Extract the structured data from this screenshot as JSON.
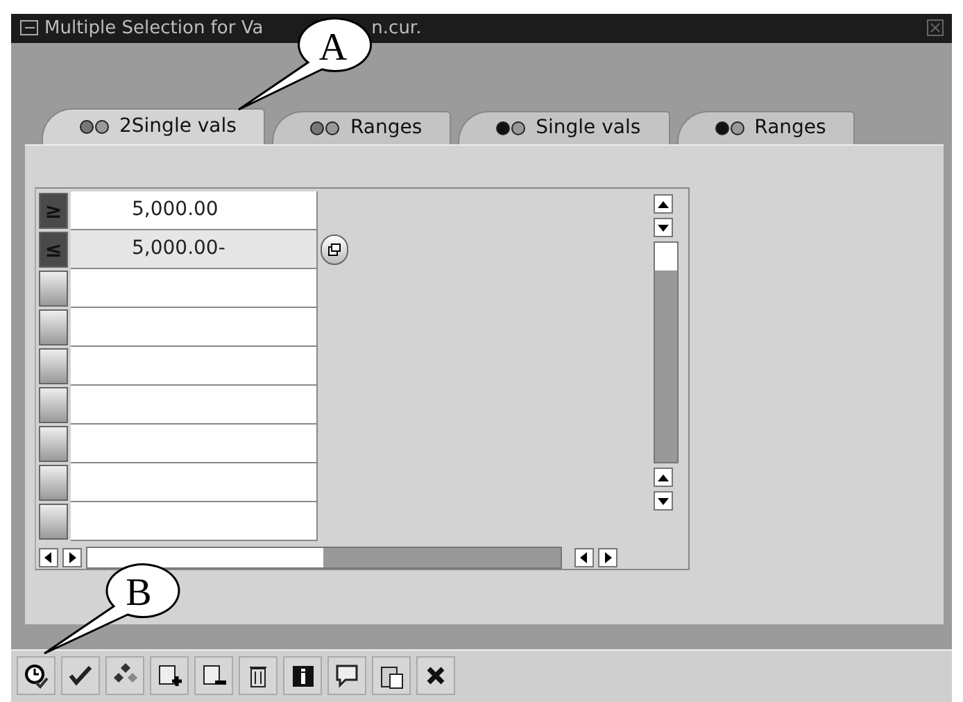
{
  "window": {
    "title_parts": [
      "Multiple Selection for Va",
      "n.cur."
    ]
  },
  "tabs": [
    {
      "label": "2Single vals",
      "selected": true,
      "kind": "include"
    },
    {
      "label": "Ranges",
      "selected": false,
      "kind": "include"
    },
    {
      "label": "Single vals",
      "selected": false,
      "kind": "exclude"
    },
    {
      "label": "Ranges",
      "selected": false,
      "kind": "exclude"
    }
  ],
  "rows": [
    {
      "sign": "≥",
      "value": "5,000.00",
      "selected": false
    },
    {
      "sign": "≤",
      "value": "5,000.00-",
      "selected": true
    },
    {
      "selected": false
    },
    {
      "selected": false
    },
    {
      "selected": false
    },
    {
      "selected": false
    },
    {
      "selected": false
    },
    {
      "selected": false
    },
    {
      "selected": false
    }
  ],
  "callouts": [
    {
      "label": "A"
    },
    {
      "label": "B"
    }
  ]
}
